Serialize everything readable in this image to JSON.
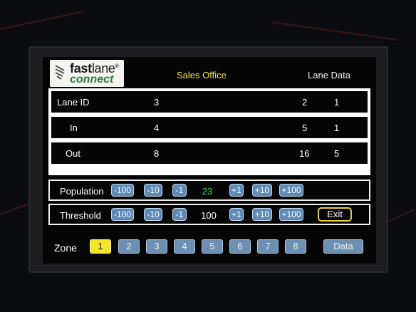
{
  "header": {
    "logo_top_a": "fast",
    "logo_top_b": "lane",
    "logo_reg": "®",
    "logo_bottom": "connect",
    "title": "Sales Office",
    "right_label": "Lane Data"
  },
  "lanes": {
    "header_row": {
      "label": "Lane ID",
      "c1": "3",
      "c2": "2",
      "c3": "1"
    },
    "in_row": {
      "label": "In",
      "c1": "4",
      "c2": "5",
      "c3": "1"
    },
    "out_row": {
      "label": "Out",
      "c1": "8",
      "c2": "16",
      "c3": "5"
    }
  },
  "population": {
    "label": "Population",
    "minus100": "-100",
    "minus10": "-10",
    "minus1": "-1",
    "value": "23",
    "plus1": "+1",
    "plus10": "+10",
    "plus100": "+100"
  },
  "threshold": {
    "label": "Threshold",
    "minus100": "-100",
    "minus10": "-10",
    "minus1": "-1",
    "value": "100",
    "plus1": "+1",
    "plus10": "+10",
    "plus100": "+100",
    "exit": "Exit"
  },
  "zone": {
    "label": "Zone",
    "buttons": [
      "1",
      "2",
      "3",
      "4",
      "5",
      "6",
      "7",
      "8"
    ],
    "selected": "1",
    "data": "Data"
  },
  "colors": {
    "accent_yellow": "#f3e629",
    "value_green": "#36e04a",
    "button_blue": "#5d8bb8"
  }
}
